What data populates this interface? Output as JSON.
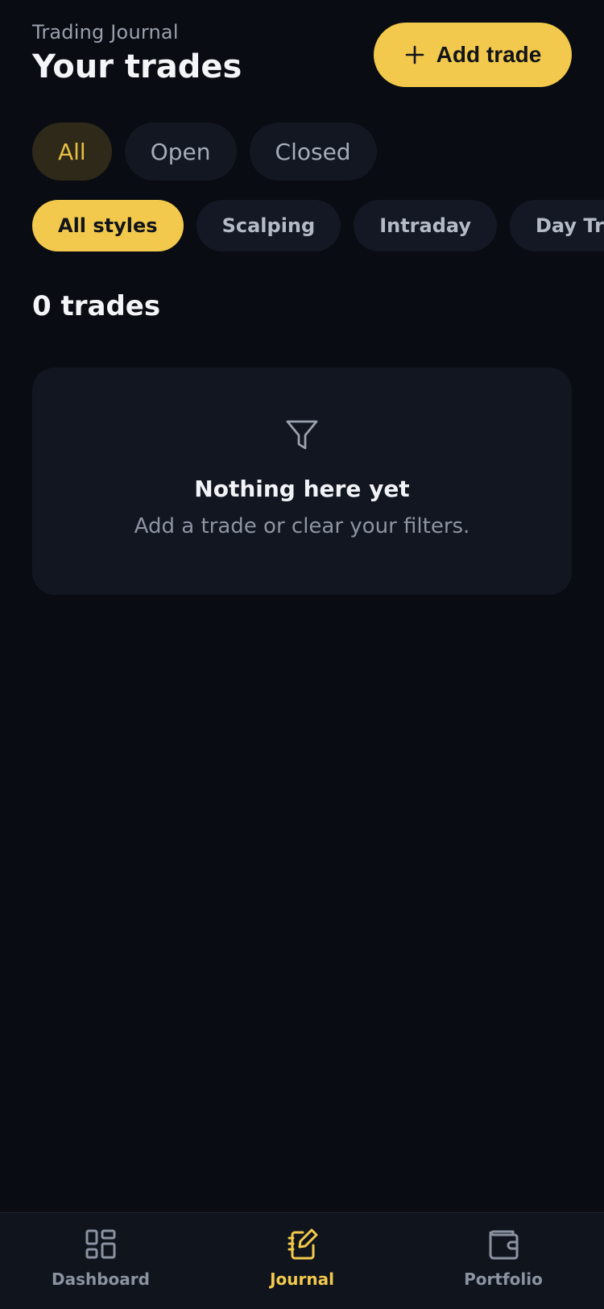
{
  "header": {
    "eyebrow": "Trading Journal",
    "title": "Your trades",
    "add_button_label": "Add trade"
  },
  "status_filters": [
    {
      "label": "All",
      "active": true
    },
    {
      "label": "Open",
      "active": false
    },
    {
      "label": "Closed",
      "active": false
    }
  ],
  "style_filters": [
    {
      "label": "All styles",
      "active": true
    },
    {
      "label": "Scalping",
      "active": false
    },
    {
      "label": "Intraday",
      "active": false
    },
    {
      "label": "Day Trading",
      "active": false
    }
  ],
  "trade_count_label": "0 trades",
  "empty_state": {
    "icon": "filter-funnel-icon",
    "title": "Nothing here yet",
    "subtitle": "Add a trade or clear your filters."
  },
  "bottom_nav": [
    {
      "label": "Dashboard",
      "icon": "dashboard-grid-icon",
      "active": false
    },
    {
      "label": "Journal",
      "icon": "journal-edit-icon",
      "active": true
    },
    {
      "label": "Portfolio",
      "icon": "wallet-icon",
      "active": false
    }
  ],
  "colors": {
    "background": "#090c12",
    "accent": "#f2c94c",
    "surface": "#121620",
    "muted_text": "#8d94a2"
  }
}
